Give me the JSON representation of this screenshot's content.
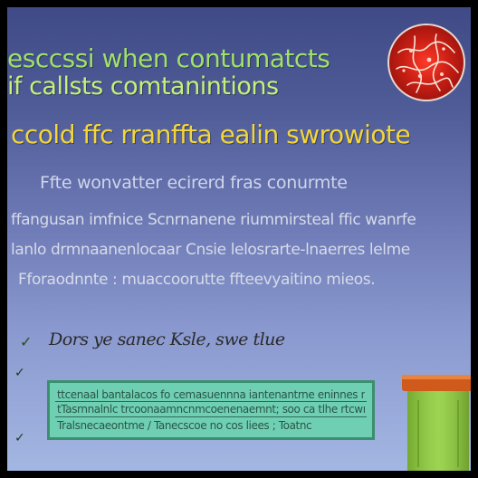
{
  "headline": {
    "line1": "esccssi when contumatcts",
    "line2": "if callsts comtanintions",
    "line3": "ccold ffc rranffta ealin swrowiote"
  },
  "subheading": "Ffte wonvatter ecirerd fras conurmte",
  "paragraph": {
    "line1": "ffangusan imfnice Scnrnanene riummirsteal ffic wanrfe",
    "line2": "lanlo drmnaanenlocaar Cnsie lelosrarte-lnaerres lelme",
    "line3": "Fforaodnnte : muaccoorutte ffteevyaitino mieos."
  },
  "handwritten_note": "Dors ye sanec Ksle, swe tlue",
  "note_box": {
    "line1": "ttcenaal bantalacos fo cemasuennna iantenantrne eninnes naacnnc",
    "line2": "tTasrnnalnlc trcoonaamncnmcoenenaemnt; soo ca tlhe rtcwnccs",
    "line3": "Tralsnecaeontme    /  Tanecscoe no cos liees ; Toatnc"
  },
  "icons": {
    "check": "✓",
    "tick": "✓",
    "circle_graphic": "red-cell-icon",
    "container_graphic": "container-icon"
  },
  "colors": {
    "title_green": "#9fe16a",
    "title_yellow": "#f2d63b",
    "box_fill": "#6fcfb3",
    "box_border": "#3c8f6e",
    "circle_red": "#c81e14",
    "cup_lid": "#d05a1c",
    "cup_body": "#8fcf3a"
  }
}
